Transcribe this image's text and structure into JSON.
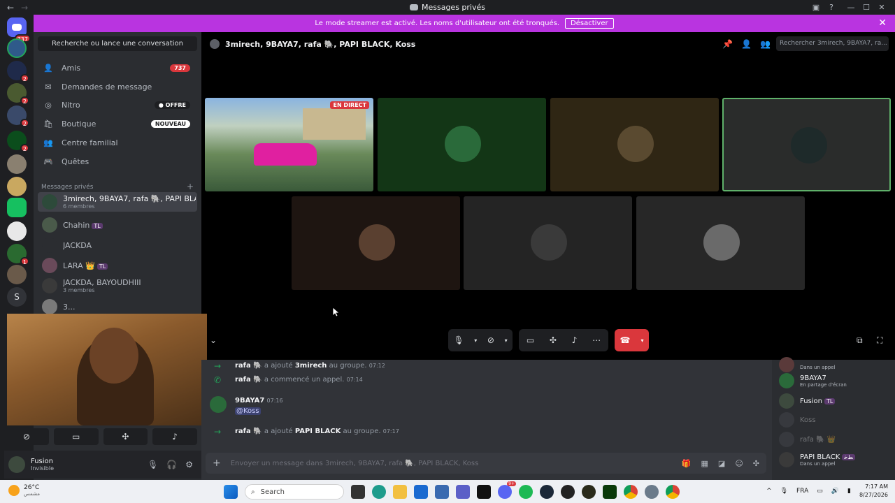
{
  "window": {
    "title": "Messages privés"
  },
  "banner": {
    "text": "Le mode streamer est activé. Les noms d'utilisateur ont été tronqués.",
    "button": "Désactiver"
  },
  "rail": {
    "home_badge": "737",
    "badges": [
      "2",
      "2",
      "2",
      "2",
      "1"
    ],
    "letter_server": "S"
  },
  "sidebar": {
    "search": "Recherche ou lance une conversation",
    "nav": [
      {
        "label": "Amis",
        "badge": "737"
      },
      {
        "label": "Demandes de message"
      },
      {
        "label": "Nitro",
        "badge": "OFFRE"
      },
      {
        "label": "Boutique",
        "badge": "NOUVEAU"
      },
      {
        "label": "Centre familial"
      },
      {
        "label": "Quêtes"
      }
    ],
    "dm_header": "Messages privés",
    "dms": [
      {
        "name": "3mirech, 9BAYA7, rafa 🐘, PAPI BLACK,...",
        "sub": "6 membres"
      },
      {
        "name": "Chahin",
        "tag": "TL"
      },
      {
        "name": "JACKDA"
      },
      {
        "name": "LARA 👑",
        "tag": "TL"
      },
      {
        "name": "JACKDA, BAYOUDHIII",
        "sub": "3 membres"
      },
      {
        "name": "3..."
      }
    ]
  },
  "user": {
    "name": "Fusion",
    "status": "Invisible"
  },
  "call": {
    "title": "3mirech, 9BAYA7, rafa 🐘, PAPI BLACK, Koss",
    "search_placeholder": "Rechercher 3mirech, 9BAYA7, ra...",
    "live_label": "EN DIRECT"
  },
  "chat": {
    "events": [
      {
        "user": "rafa 🐘",
        "text": " a ajouté ",
        "target": "3mirech",
        "suffix": " au groupe.",
        "time": "07:12"
      },
      {
        "user": "rafa 🐘",
        "text": " a commencé un appel.",
        "time": "07:14"
      },
      {
        "user": "9BAYA7",
        "time": "07:16",
        "mention": "@Koss"
      },
      {
        "user": "rafa 🐘",
        "text": " a ajouté ",
        "target": "PAPI BLACK",
        "suffix": " au groupe.",
        "time": "07:17"
      }
    ],
    "placeholder": "Envoyer un message dans 3mirech, 9BAYA7, rafa 🐘, PAPI BLACK, Koss"
  },
  "members": [
    {
      "status": "Dans un appel"
    },
    {
      "name": "9BAYA7",
      "status": "En partage d'écran"
    },
    {
      "name": "Fusion",
      "tag": "TL"
    },
    {
      "name": "Koss"
    },
    {
      "name": "rafa 🐘 👑"
    },
    {
      "name": "PAPI BLACK",
      "tag": "ﻂﺧ",
      "status": "Dans un appel"
    }
  ],
  "taskbar": {
    "temp": "26°C",
    "weather_desc": "مشمس",
    "search": "Search",
    "lang": "FRA",
    "time": "7:17 AM",
    "date": "8/27/2026",
    "discord_badge": "9+"
  },
  "colors": {
    "banner": "#b934e0",
    "accent": "#5865f2",
    "danger": "#da373c",
    "online": "#23a55a"
  }
}
